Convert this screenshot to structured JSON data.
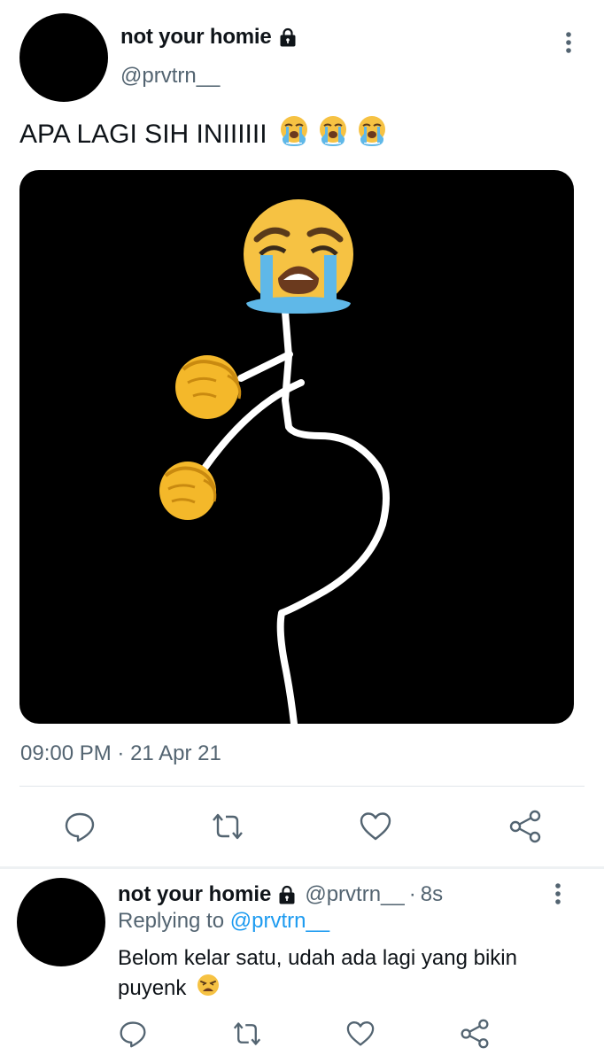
{
  "tweet": {
    "display_name": "not your homie",
    "handle": "@prvtrn__",
    "text": "APA LAGI SIH INIIIIII",
    "text_emoji": "loudly-crying-face",
    "text_emoji_count": 3,
    "media": {
      "background": "#000000",
      "description_icons": [
        "loudly-crying-face-emoji",
        "raised-fist-emoji",
        "raised-fist-emoji"
      ]
    },
    "time": "09:00 PM",
    "separator": "·",
    "date": "21 Apr 21"
  },
  "actions": {
    "reply_icon": "reply-icon",
    "retweet_icon": "retweet-icon",
    "like_icon": "heart-icon",
    "share_icon": "share-icon"
  },
  "reply": {
    "display_name": "not your homie",
    "handle": "@prvtrn__",
    "separator": "·",
    "time": "8s",
    "replying_label": "Replying to",
    "replying_to": "@prvtrn__",
    "text": "Belom kelar satu, udah ada lagi yang bikin puyenk",
    "text_emoji": "weary-face"
  },
  "colors": {
    "text_primary": "#0f1419",
    "text_secondary": "#536471",
    "link": "#1d9bf0",
    "divider": "#e1e6ea"
  }
}
